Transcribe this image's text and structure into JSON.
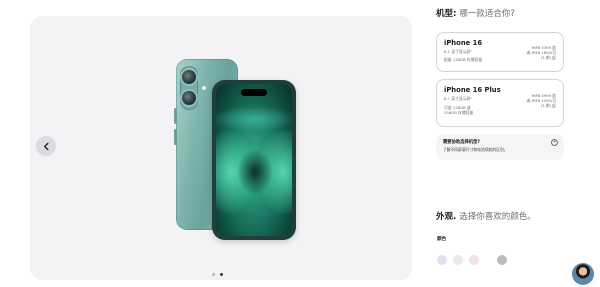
{
  "gallery": {
    "prev_icon": "chevron-left-icon",
    "dots_total": 2,
    "dots_active": 2
  },
  "model_section": {
    "title": "机型",
    "subtitle": "哪一款适合你?"
  },
  "models": [
    {
      "name": "iPhone 16",
      "size_label": "6.1 英寸显示屏¹",
      "storage_label": "配备 128GB 存储容量",
      "price_lines": [
        "RMB 5399 起",
        "或 RMB 1800/月",
        "(3 期) 起"
      ]
    },
    {
      "name": "iPhone 16 Plus",
      "size_label": "6.7 英寸显示屏¹",
      "storage_label": "可选 128GB 或",
      "storage_label_2": "256GB 存储容量",
      "price_lines": [
        "RMB 5999 起",
        "或 RMB 2000/月",
        "(3 期) 起"
      ]
    }
  ],
  "help": {
    "title": "需要协助选择机型?",
    "text": "了解不同屏幕尺寸和电池续航的区别。",
    "icon": "plus-circle-icon"
  },
  "finish_section": {
    "title": "外观",
    "subtitle": "选择你喜欢的颜色。"
  },
  "color_label": "颜色",
  "swatches": [
    {
      "color": "#dfe2ef"
    },
    {
      "color": "#eaeaec"
    },
    {
      "color": "#f4e2e6"
    },
    {
      "color": "#bcbcbe"
    }
  ],
  "avatar": {
    "icon": "chat-specialist-avatar"
  }
}
